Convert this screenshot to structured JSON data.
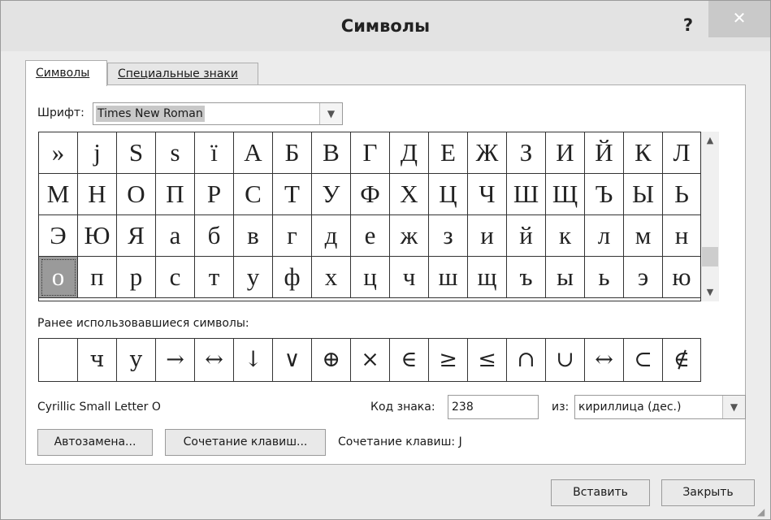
{
  "window": {
    "title": "Символы",
    "help_label": "?",
    "close_label": "✕"
  },
  "tabs": [
    {
      "label": "Символы",
      "active": true
    },
    {
      "label": "Специальные знаки",
      "active": false
    }
  ],
  "font": {
    "label": "Шрифт:",
    "value": "Times New Roman"
  },
  "symbol_grid": {
    "rows": [
      [
        "»",
        "j",
        "S",
        "s",
        "ï",
        "А",
        "Б",
        "В",
        "Г",
        "Д",
        "Е",
        "Ж",
        "З",
        "И",
        "Й",
        "К",
        "Л"
      ],
      [
        "М",
        "Н",
        "О",
        "П",
        "Р",
        "С",
        "Т",
        "У",
        "Ф",
        "Х",
        "Ц",
        "Ч",
        "Ш",
        "Щ",
        "Ъ",
        "Ы",
        "Ь"
      ],
      [
        "Э",
        "Ю",
        "Я",
        "а",
        "б",
        "в",
        "г",
        "д",
        "е",
        "ж",
        "з",
        "и",
        "й",
        "к",
        "л",
        "м",
        "н"
      ],
      [
        "о",
        "п",
        "р",
        "с",
        "т",
        "у",
        "ф",
        "х",
        "ц",
        "ч",
        "ш",
        "щ",
        "ъ",
        "ы",
        "ь",
        "э",
        "ю"
      ]
    ],
    "selected": "о"
  },
  "recent": {
    "label": "Ранее использовавшиеся символы:",
    "symbols": [
      "",
      "ч",
      "у",
      "→",
      "↔",
      "↓",
      "∨",
      "⊕",
      "×",
      "∈",
      "≥",
      "≤",
      "∩",
      "∪",
      "↔",
      "⊂",
      "∉"
    ]
  },
  "char_name": "Cyrillic Small Letter O",
  "code": {
    "label": "Код знака:",
    "value": "238"
  },
  "from": {
    "label": "из:",
    "value": "кириллица (дес.)"
  },
  "buttons": {
    "autocorrect": "Автозамена...",
    "shortcut_key": "Сочетание клавиш...",
    "insert": "Вставить",
    "close": "Закрыть"
  },
  "shortcut_text": "Сочетание клавиш: J",
  "icons": {
    "dropdown": "chevron-down-icon",
    "scroll_up": "chevron-up-icon",
    "scroll_down": "chevron-down-icon",
    "resize": "resize-grip-icon"
  }
}
